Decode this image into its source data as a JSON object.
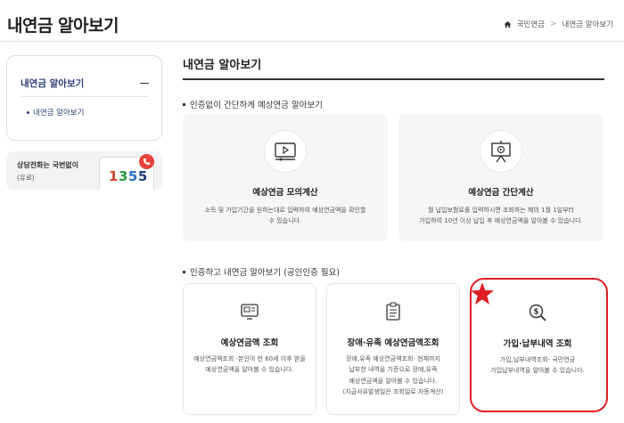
{
  "page": {
    "title": "내연금 알아보기"
  },
  "breadcrumb": {
    "items": [
      "국민연금",
      "내연금 알아보기"
    ],
    "separator": ">"
  },
  "sidebar": {
    "menu_title": "내연금 알아보기",
    "sub_items": [
      {
        "label": "내연금 알아보기"
      }
    ],
    "phone": {
      "label": "상담전화는 국번없이",
      "note": "(유료)",
      "digits": [
        "1",
        "3",
        "5",
        "5"
      ]
    }
  },
  "main": {
    "title": "내연금 알아보기",
    "section1": {
      "title": "인증없이 간단하게 예상연금 알아보기",
      "cards": [
        {
          "title": "예상연금 모의계산",
          "desc_lines": [
            "소득 및 가입기간을 원하는대로 입력하여 예상연금액을 확인할",
            "수 있습니다."
          ]
        },
        {
          "title": "예상연금 간단계산",
          "desc_lines": [
            "월 납입보험료를 입력하시면 조회하는 해의 1월 1일부터",
            "가입하여 10년 이상 납입 후 예상연금액을 알아볼 수 있습니다."
          ]
        }
      ]
    },
    "section2": {
      "title": "인증하고 내연금 알아보기 (공인인증 필요)",
      "cards": [
        {
          "title": "예상연금액 조회",
          "desc_lines": [
            "예상연금액조회 -본인이 만 60세 이후 받을",
            "예상연금액을 알아볼 수 있습니다."
          ]
        },
        {
          "title": "장애·유족 예상연금액조회",
          "desc_lines": [
            "장애,유족 예상연금액조회- 현재까지",
            "납부한 내역을 기준으로 장애,유족",
            "예상연금액을 알아볼 수 있습니다.",
            "(지급사유발생일은 조회일로 자동계산)"
          ]
        },
        {
          "title": "가입·납부내역 조회",
          "desc_lines": [
            "가입,납부내역조회- 국민연금",
            "가입납부내역을 알아볼 수 있습니다."
          ]
        }
      ]
    }
  },
  "colors": {
    "accent_red": "#e01f24",
    "navy": "#2c3e75",
    "card_bg": "#f5f6f8"
  },
  "icons": [
    "home-icon",
    "minus-icon",
    "phone-icon",
    "video-play-icon",
    "presentation-icon",
    "monitor-card-icon",
    "clipboard-icon",
    "search-dollar-icon",
    "star-icon"
  ]
}
